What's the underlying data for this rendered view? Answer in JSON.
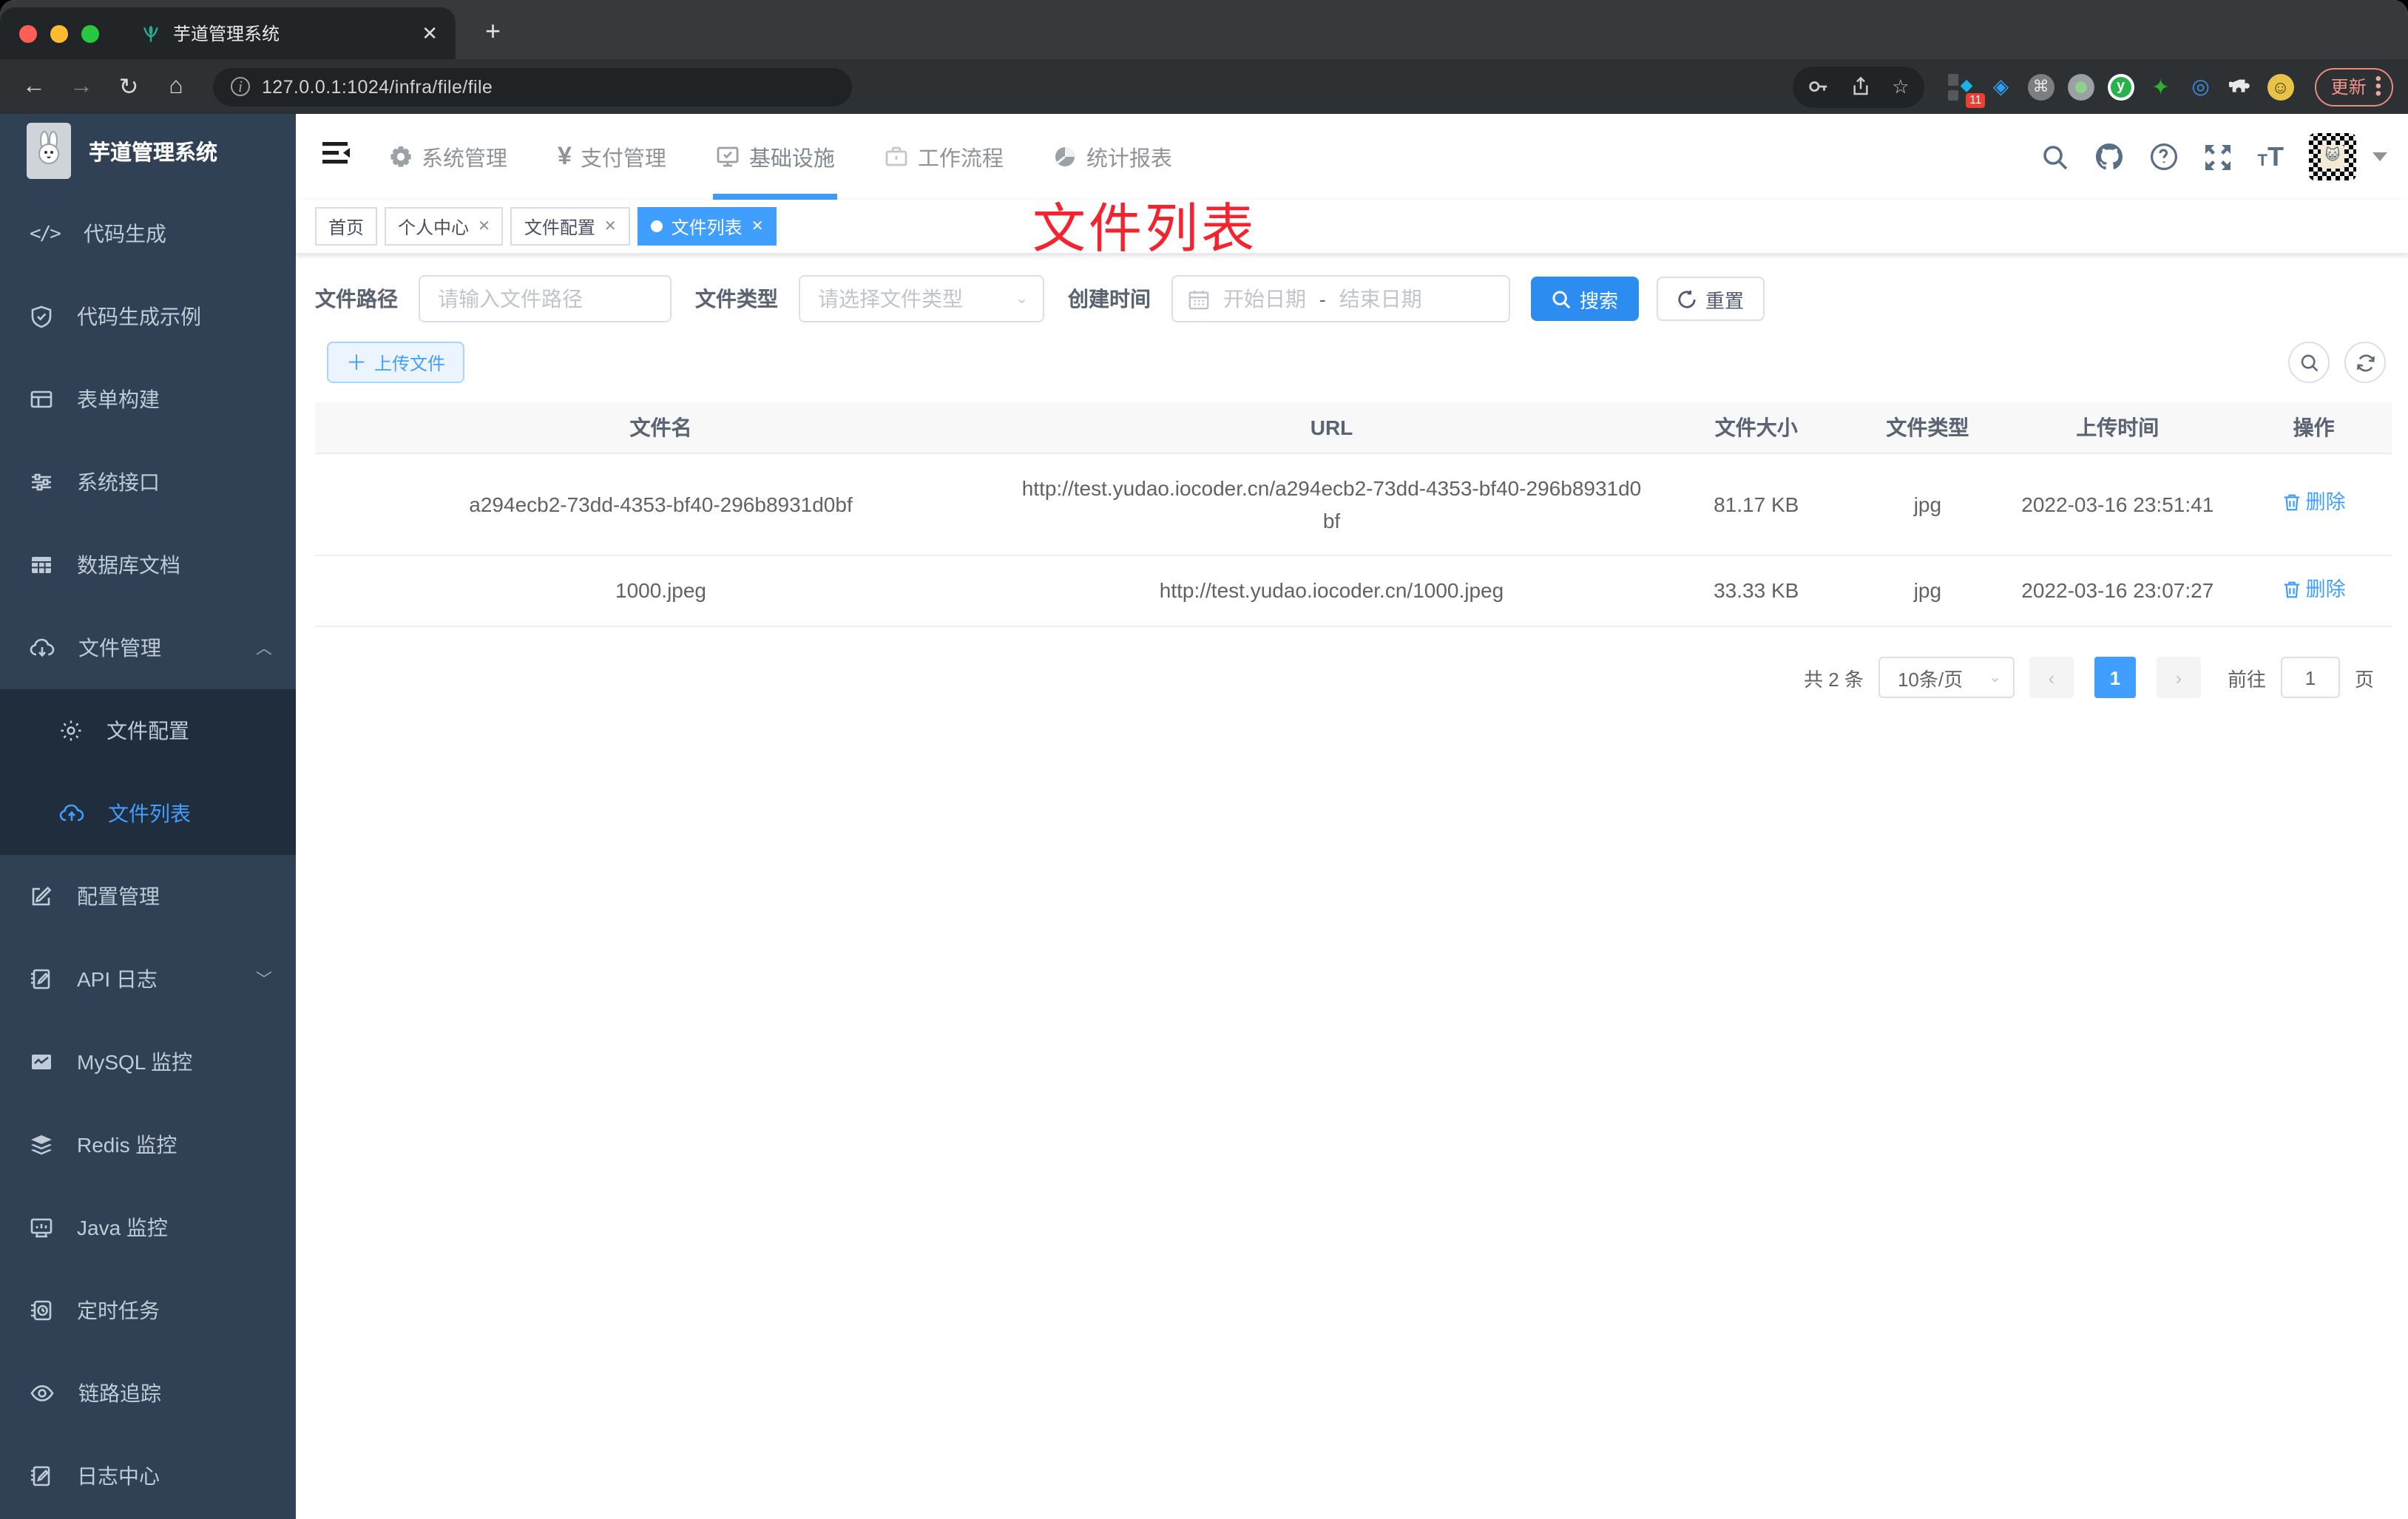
{
  "browser": {
    "tab_title": "芋道管理系统",
    "tab_close": "✕",
    "new_tab": "+",
    "url": "127.0.0.1:1024/infra/file/file",
    "extension_badge": "11",
    "update_label": "更新"
  },
  "header": {
    "app_title": "芋道管理系统",
    "nav": [
      {
        "label": "系统管理"
      },
      {
        "label": "支付管理"
      },
      {
        "label": "基础设施",
        "active": true
      },
      {
        "label": "工作流程"
      },
      {
        "label": "统计报表"
      }
    ]
  },
  "sidebar": {
    "items": [
      {
        "label": "代码生成"
      },
      {
        "label": "代码生成示例"
      },
      {
        "label": "表单构建"
      },
      {
        "label": "系统接口"
      },
      {
        "label": "数据库文档"
      },
      {
        "label": "文件管理",
        "expanded": true,
        "children": [
          {
            "label": "文件配置"
          },
          {
            "label": "文件列表",
            "active": true
          }
        ]
      },
      {
        "label": "配置管理"
      },
      {
        "label": "API 日志"
      },
      {
        "label": "MySQL 监控"
      },
      {
        "label": "Redis 监控"
      },
      {
        "label": "Java 监控"
      },
      {
        "label": "定时任务"
      },
      {
        "label": "链路追踪"
      },
      {
        "label": "日志中心"
      }
    ]
  },
  "tags": {
    "items": [
      {
        "label": "首页"
      },
      {
        "label": "个人中心",
        "closable": true
      },
      {
        "label": "文件配置",
        "closable": true
      },
      {
        "label": "文件列表",
        "closable": true,
        "active": true
      }
    ]
  },
  "annotation": {
    "text": "文件列表",
    "color": "#f5232d"
  },
  "filters": {
    "path_label": "文件路径",
    "path_placeholder": "请输入文件路径",
    "type_label": "文件类型",
    "type_placeholder": "请选择文件类型",
    "date_label": "创建时间",
    "date_start": "开始日期",
    "date_separator": "-",
    "date_end": "结束日期",
    "search_label": "搜索",
    "reset_label": "重置"
  },
  "toolbar": {
    "upload_label": "上传文件"
  },
  "table": {
    "headers": [
      "文件名",
      "URL",
      "文件大小",
      "文件类型",
      "上传时间",
      "操作"
    ],
    "rows": [
      {
        "name": "a294ecb2-73dd-4353-bf40-296b8931d0bf",
        "url": "http://test.yudao.iocoder.cn/a294ecb2-73dd-4353-bf40-296b8931d0bf",
        "size": "81.17 KB",
        "type": "jpg",
        "time": "2022-03-16 23:51:41",
        "action": "删除"
      },
      {
        "name": "1000.jpeg",
        "url": "http://test.yudao.iocoder.cn/1000.jpeg",
        "size": "33.33 KB",
        "type": "jpg",
        "time": "2022-03-16 23:07:27",
        "action": "删除"
      }
    ]
  },
  "pagination": {
    "total_text": "共 2 条",
    "page_size": "10条/页",
    "prev": "‹",
    "page": "1",
    "next": "›",
    "goto_label": "前往",
    "goto_value": "1",
    "goto_unit": "页"
  },
  "colors": {
    "accent": "#409eff",
    "sidebar_bg": "#304156",
    "annotation_red": "#f5232d"
  }
}
